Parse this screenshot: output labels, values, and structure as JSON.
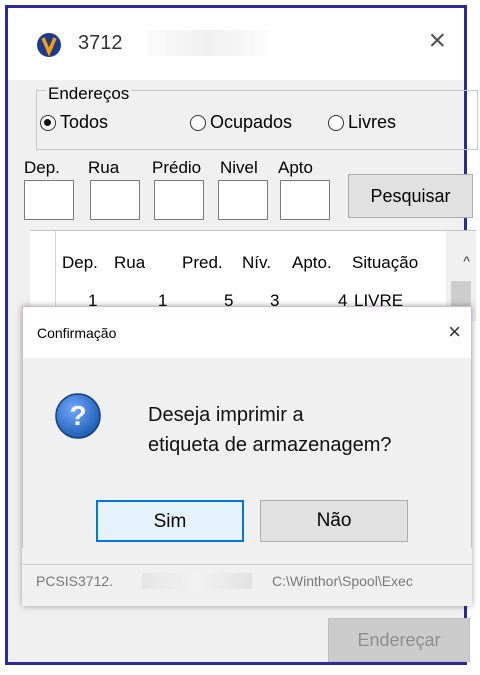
{
  "window": {
    "title": "3712",
    "close": "×"
  },
  "enderecos": {
    "group_label": "Endereços",
    "radios": [
      {
        "label": "Todos",
        "selected": true
      },
      {
        "label": "Ocupados",
        "selected": false
      },
      {
        "label": "Livres",
        "selected": false
      }
    ]
  },
  "filters": {
    "labels": [
      "Dep.",
      "Rua",
      "Prédio",
      "Nivel",
      "Apto"
    ],
    "values": [
      "",
      "",
      "",
      "",
      ""
    ],
    "search_button": "Pesquisar"
  },
  "grid": {
    "headers": [
      "Dep.",
      "Rua",
      "Pred.",
      "Nív.",
      "Apto.",
      "Situação"
    ],
    "rows": [
      [
        "1",
        "1",
        "5",
        "3",
        "4",
        "LIVRE"
      ]
    ],
    "scroll_up": "^"
  },
  "dialog": {
    "title": "Confirmação",
    "close": "×",
    "message_line1": "Deseja imprimir a",
    "message_line2": "etiqueta de armazenagem?",
    "icon_text": "?",
    "yes": "Sim",
    "no": "Não"
  },
  "status": {
    "left": "PCSIS3712.",
    "right": "C:\\Winthor\\Spool\\Exec"
  },
  "footer": {
    "enderecar_button": "Endereçar"
  },
  "colors": {
    "frame": "#2a2a9a",
    "dialog_border": "#d8b4d8",
    "primary_focus": "#0078d7",
    "question_icon": "#1f5fb4"
  }
}
